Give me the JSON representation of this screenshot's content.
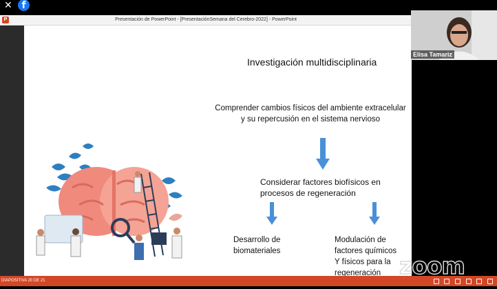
{
  "window": {
    "title": "Presentación de PowerPoint - [PresentaciónSemana del Cerebro-2022] - PowerPoint"
  },
  "slide": {
    "title": "Investigación multidisciplinaria",
    "block1_line1": "Comprender cambios físicos del ambiente extracelular",
    "block1_line2": "y su repercusión en el sistema nervioso",
    "block2_line1": "Considerar factores biofísicos en",
    "block2_line2": "procesos de regeneración",
    "block3_line1": "Desarrollo de",
    "block3_line2": "biomateriales",
    "block4_line1": "Modulación de factores químicos",
    "block4_line2": "Y físicos para la regeneración"
  },
  "statusbar": {
    "slide_counter": "DIAPOSITIVA 20 DE 21"
  },
  "video": {
    "participant_name": "Elisa Tamariz"
  },
  "branding": {
    "watermark": "zoom"
  },
  "colors": {
    "accent": "#d24726",
    "arrow": "#4a90d9"
  }
}
